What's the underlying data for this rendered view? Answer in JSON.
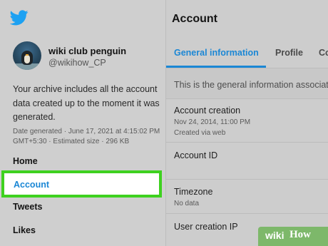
{
  "brand": {
    "logo_icon": "twitter-bird-icon",
    "color": "#1da1f2"
  },
  "account": {
    "name": "wiki club penguin",
    "handle": "@wikihow_CP"
  },
  "sidebar": {
    "description": "Your archive includes all the account data created up to the moment it was generated.",
    "meta": "Date generated · June 17, 2021 at 4:15:02 PM GMT+5:30 · Estimated size · 296 KB",
    "nav": [
      "Home",
      "Account",
      "Tweets",
      "Likes"
    ],
    "active": "Account",
    "highlight_color": "#3ed11f",
    "link_color": "#1b87d5"
  },
  "main": {
    "title": "Account",
    "tabs": [
      "General information",
      "Profile",
      "Co"
    ],
    "active_tab": "General information",
    "intro": "This is the general information associate",
    "rows": [
      {
        "title": "Account creation",
        "value": "Nov 24, 2014, 11:00 PM",
        "sub": "Created via web"
      },
      {
        "title": "Account ID"
      },
      {
        "title": "Timezone",
        "value": "No data"
      },
      {
        "title": "User creation IP"
      }
    ]
  },
  "watermark": {
    "part1": "wiki",
    "part2": "How",
    "color": "#7db86a"
  }
}
